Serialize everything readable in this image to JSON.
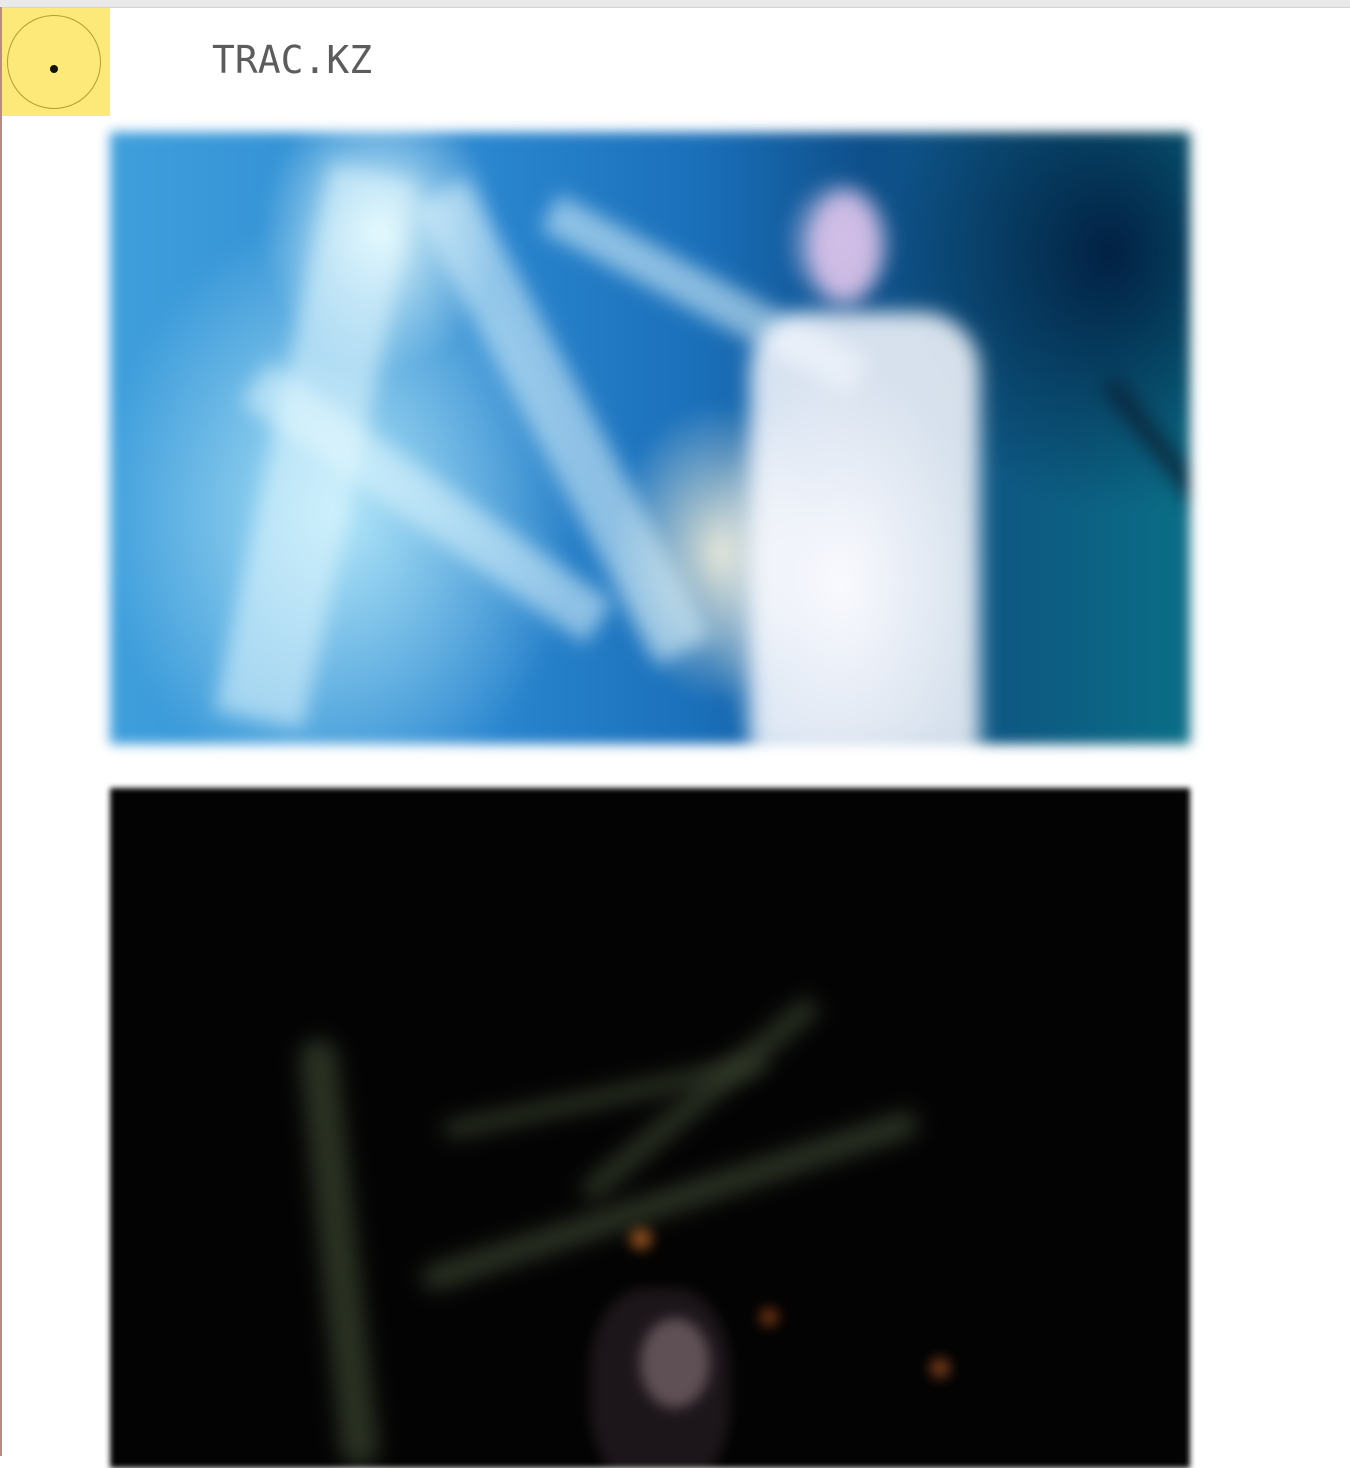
{
  "header": {
    "site_title": "TRAC.KZ",
    "menu_icon": "menu-dot-icon",
    "menu_button_color": "#fce97a"
  },
  "feed": {
    "items": [
      {
        "kind": "photo",
        "description_visible": false
      },
      {
        "kind": "photo",
        "description_visible": false
      }
    ]
  }
}
